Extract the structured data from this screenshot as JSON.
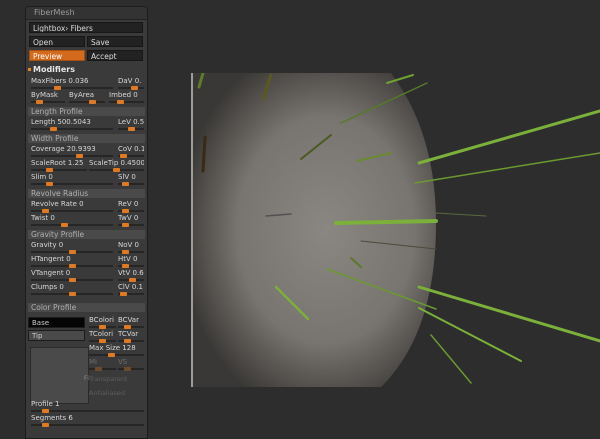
{
  "panel": {
    "title": "FiberMesh",
    "lightbox": "Lightbox› Fibers",
    "open": "Open",
    "save": "Save",
    "preview": "Preview",
    "accept": "Accept",
    "modifiers": "Modifiers"
  },
  "sliders": {
    "maxfibers": {
      "label": "MaxFibers 0.036",
      "value": 0.3
    },
    "dav": {
      "label": "DaV 0.",
      "value": 0.7
    },
    "bymask": {
      "label": "ByMask",
      "value": 0.2
    },
    "byarea": {
      "label": "ByArea",
      "value": 0.7
    },
    "imbed": {
      "label": "Imbed 0",
      "value": 0.3
    },
    "length": {
      "label": "Length 500.5043",
      "value": 0.25
    },
    "lev": {
      "label": "LeV 0.5",
      "value": 0.5
    },
    "coverage": {
      "label": "Coverage 20.9393",
      "value": 0.6
    },
    "cov": {
      "label": "CoV 0.1",
      "value": 0.1
    },
    "scaleroot": {
      "label": "ScaleRoot 1.25",
      "value": 0.3
    },
    "scaletip": {
      "label": "ScaleTip 0.4500",
      "value": 0.5
    },
    "slim": {
      "label": "Slim 0",
      "value": 0.2
    },
    "slv": {
      "label": "SlV 0",
      "value": 0.2
    },
    "revolve_rate": {
      "label": "Revolve Rate 0",
      "value": 0.15
    },
    "rev": {
      "label": "ReV 0",
      "value": 0.2
    },
    "twist": {
      "label": "Twist 0",
      "value": 0.4
    },
    "twv": {
      "label": "TwV 0",
      "value": 0.2
    },
    "gravity": {
      "label": "Gravity 0",
      "value": 0.5
    },
    "nov": {
      "label": "NoV 0",
      "value": 0.2
    },
    "htangent": {
      "label": "HTangent 0",
      "value": 0.5
    },
    "htv": {
      "label": "HtV 0",
      "value": 0.2
    },
    "vtangent": {
      "label": "VTangent 0",
      "value": 0.5
    },
    "vtv": {
      "label": "VtV 0.6",
      "value": 0.6
    },
    "clumps": {
      "label": "Clumps 0",
      "value": 0.5
    },
    "clv": {
      "label": "ClV 0.1",
      "value": 0.1
    },
    "bcolori": {
      "label": "BColori",
      "value": 0.5
    },
    "bcvar": {
      "label": "BCVar",
      "value": 0.3
    },
    "tcolori": {
      "label": "TColori",
      "value": 0.5
    },
    "tcvar": {
      "label": "TCVar",
      "value": 0.3
    },
    "maxsize": {
      "label": "Max Size 128",
      "value": 0.4
    },
    "mi": {
      "label": "Mi",
      "value": 0.3
    },
    "vs": {
      "label": "VS",
      "value": 0.3
    },
    "profile": {
      "label": "Profile 1",
      "value": 0.1
    },
    "segments": {
      "label": "Segments 6",
      "value": 0.1
    }
  },
  "sections": {
    "length_profile": "Length Profile",
    "width_profile": "Width Profile",
    "revolve_radius": "Revolve Radius",
    "gravity_profile": "Gravity Profile",
    "color_profile": "Color Profile"
  },
  "swatches": {
    "base": "Base",
    "tip": "Tip",
    "fi": "Fi"
  },
  "dim": {
    "transparent": "Transparent",
    "antialiased": "Antialiased"
  },
  "icons": {
    "status": "orange-dot-icon"
  },
  "colors": {
    "accent": "#e07a22",
    "fiber": "#7bb03a",
    "mesh": "#7d7a76"
  }
}
